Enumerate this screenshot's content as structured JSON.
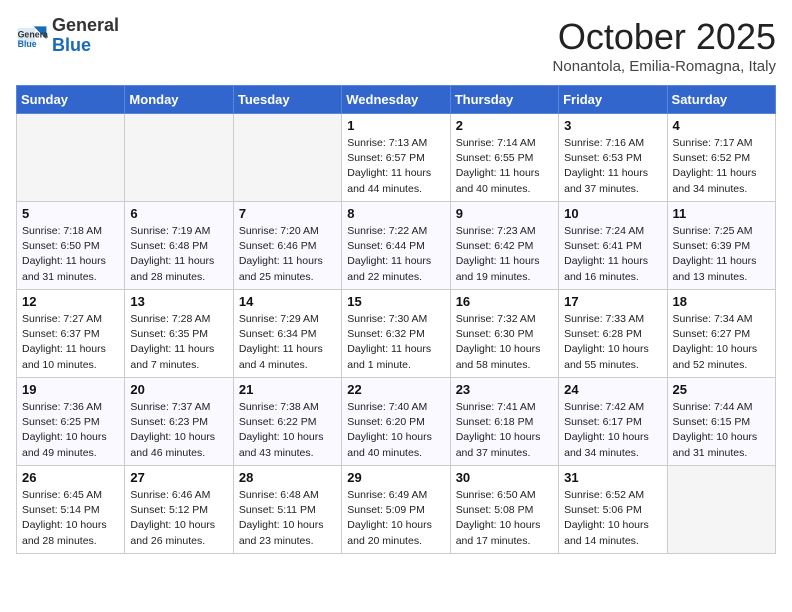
{
  "header": {
    "logo_line1": "General",
    "logo_line2": "Blue",
    "month": "October 2025",
    "location": "Nonantola, Emilia-Romagna, Italy"
  },
  "weekdays": [
    "Sunday",
    "Monday",
    "Tuesday",
    "Wednesday",
    "Thursday",
    "Friday",
    "Saturday"
  ],
  "weeks": [
    [
      {
        "day": "",
        "info": ""
      },
      {
        "day": "",
        "info": ""
      },
      {
        "day": "",
        "info": ""
      },
      {
        "day": "1",
        "info": "Sunrise: 7:13 AM\nSunset: 6:57 PM\nDaylight: 11 hours and 44 minutes."
      },
      {
        "day": "2",
        "info": "Sunrise: 7:14 AM\nSunset: 6:55 PM\nDaylight: 11 hours and 40 minutes."
      },
      {
        "day": "3",
        "info": "Sunrise: 7:16 AM\nSunset: 6:53 PM\nDaylight: 11 hours and 37 minutes."
      },
      {
        "day": "4",
        "info": "Sunrise: 7:17 AM\nSunset: 6:52 PM\nDaylight: 11 hours and 34 minutes."
      }
    ],
    [
      {
        "day": "5",
        "info": "Sunrise: 7:18 AM\nSunset: 6:50 PM\nDaylight: 11 hours and 31 minutes."
      },
      {
        "day": "6",
        "info": "Sunrise: 7:19 AM\nSunset: 6:48 PM\nDaylight: 11 hours and 28 minutes."
      },
      {
        "day": "7",
        "info": "Sunrise: 7:20 AM\nSunset: 6:46 PM\nDaylight: 11 hours and 25 minutes."
      },
      {
        "day": "8",
        "info": "Sunrise: 7:22 AM\nSunset: 6:44 PM\nDaylight: 11 hours and 22 minutes."
      },
      {
        "day": "9",
        "info": "Sunrise: 7:23 AM\nSunset: 6:42 PM\nDaylight: 11 hours and 19 minutes."
      },
      {
        "day": "10",
        "info": "Sunrise: 7:24 AM\nSunset: 6:41 PM\nDaylight: 11 hours and 16 minutes."
      },
      {
        "day": "11",
        "info": "Sunrise: 7:25 AM\nSunset: 6:39 PM\nDaylight: 11 hours and 13 minutes."
      }
    ],
    [
      {
        "day": "12",
        "info": "Sunrise: 7:27 AM\nSunset: 6:37 PM\nDaylight: 11 hours and 10 minutes."
      },
      {
        "day": "13",
        "info": "Sunrise: 7:28 AM\nSunset: 6:35 PM\nDaylight: 11 hours and 7 minutes."
      },
      {
        "day": "14",
        "info": "Sunrise: 7:29 AM\nSunset: 6:34 PM\nDaylight: 11 hours and 4 minutes."
      },
      {
        "day": "15",
        "info": "Sunrise: 7:30 AM\nSunset: 6:32 PM\nDaylight: 11 hours and 1 minute."
      },
      {
        "day": "16",
        "info": "Sunrise: 7:32 AM\nSunset: 6:30 PM\nDaylight: 10 hours and 58 minutes."
      },
      {
        "day": "17",
        "info": "Sunrise: 7:33 AM\nSunset: 6:28 PM\nDaylight: 10 hours and 55 minutes."
      },
      {
        "day": "18",
        "info": "Sunrise: 7:34 AM\nSunset: 6:27 PM\nDaylight: 10 hours and 52 minutes."
      }
    ],
    [
      {
        "day": "19",
        "info": "Sunrise: 7:36 AM\nSunset: 6:25 PM\nDaylight: 10 hours and 49 minutes."
      },
      {
        "day": "20",
        "info": "Sunrise: 7:37 AM\nSunset: 6:23 PM\nDaylight: 10 hours and 46 minutes."
      },
      {
        "day": "21",
        "info": "Sunrise: 7:38 AM\nSunset: 6:22 PM\nDaylight: 10 hours and 43 minutes."
      },
      {
        "day": "22",
        "info": "Sunrise: 7:40 AM\nSunset: 6:20 PM\nDaylight: 10 hours and 40 minutes."
      },
      {
        "day": "23",
        "info": "Sunrise: 7:41 AM\nSunset: 6:18 PM\nDaylight: 10 hours and 37 minutes."
      },
      {
        "day": "24",
        "info": "Sunrise: 7:42 AM\nSunset: 6:17 PM\nDaylight: 10 hours and 34 minutes."
      },
      {
        "day": "25",
        "info": "Sunrise: 7:44 AM\nSunset: 6:15 PM\nDaylight: 10 hours and 31 minutes."
      }
    ],
    [
      {
        "day": "26",
        "info": "Sunrise: 6:45 AM\nSunset: 5:14 PM\nDaylight: 10 hours and 28 minutes."
      },
      {
        "day": "27",
        "info": "Sunrise: 6:46 AM\nSunset: 5:12 PM\nDaylight: 10 hours and 26 minutes."
      },
      {
        "day": "28",
        "info": "Sunrise: 6:48 AM\nSunset: 5:11 PM\nDaylight: 10 hours and 23 minutes."
      },
      {
        "day": "29",
        "info": "Sunrise: 6:49 AM\nSunset: 5:09 PM\nDaylight: 10 hours and 20 minutes."
      },
      {
        "day": "30",
        "info": "Sunrise: 6:50 AM\nSunset: 5:08 PM\nDaylight: 10 hours and 17 minutes."
      },
      {
        "day": "31",
        "info": "Sunrise: 6:52 AM\nSunset: 5:06 PM\nDaylight: 10 hours and 14 minutes."
      },
      {
        "day": "",
        "info": ""
      }
    ]
  ]
}
